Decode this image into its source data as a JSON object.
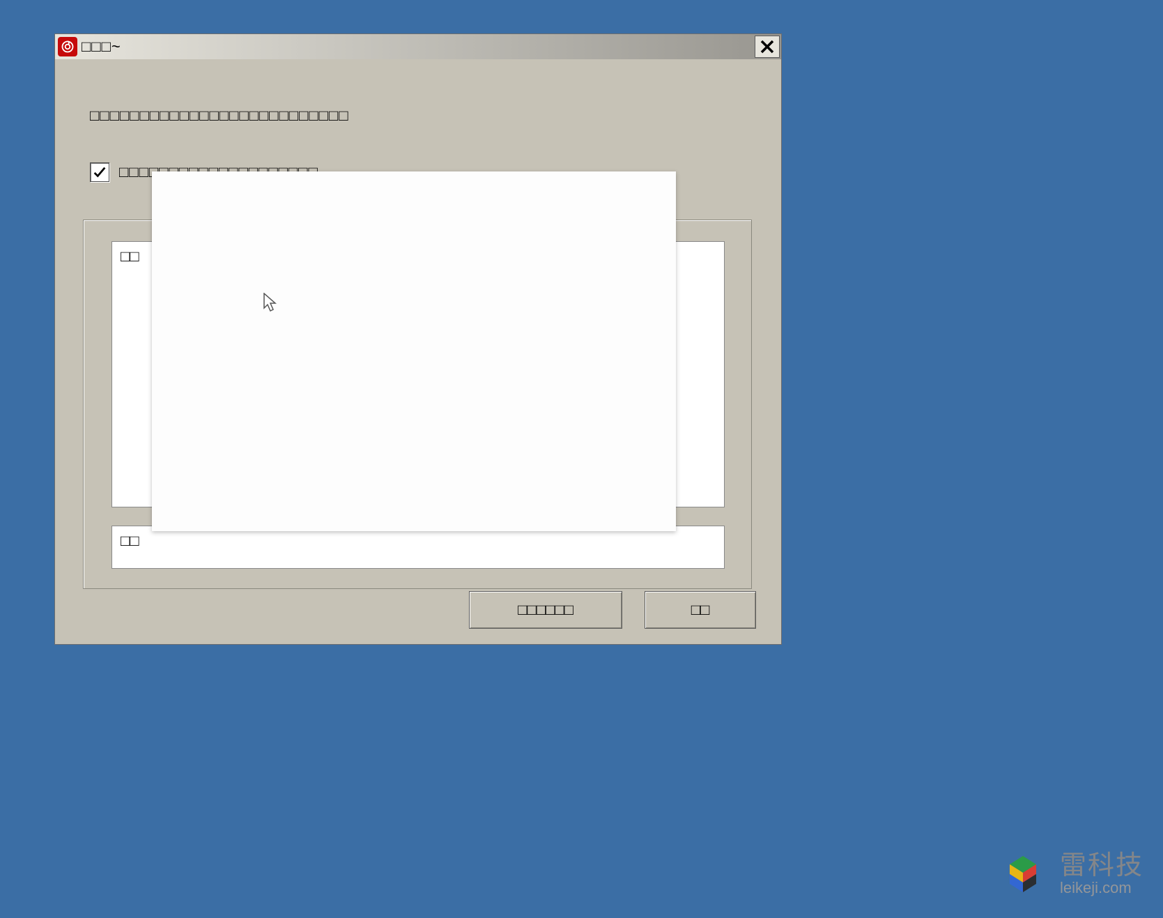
{
  "window": {
    "title": "□□□~"
  },
  "description": "□□□□□□□□□□□□□□□□□□□□□□□□□□",
  "checkbox": {
    "checked": true,
    "label": "□□□□□□□□□□□□□□□□□□□□"
  },
  "listbox1": {
    "header": "□□"
  },
  "listbox2": {
    "header": "□□"
  },
  "buttons": {
    "primary": "□□□□□□",
    "secondary": "□□"
  },
  "watermark": {
    "line1": "雷科技",
    "line2": "leikeji.com"
  }
}
